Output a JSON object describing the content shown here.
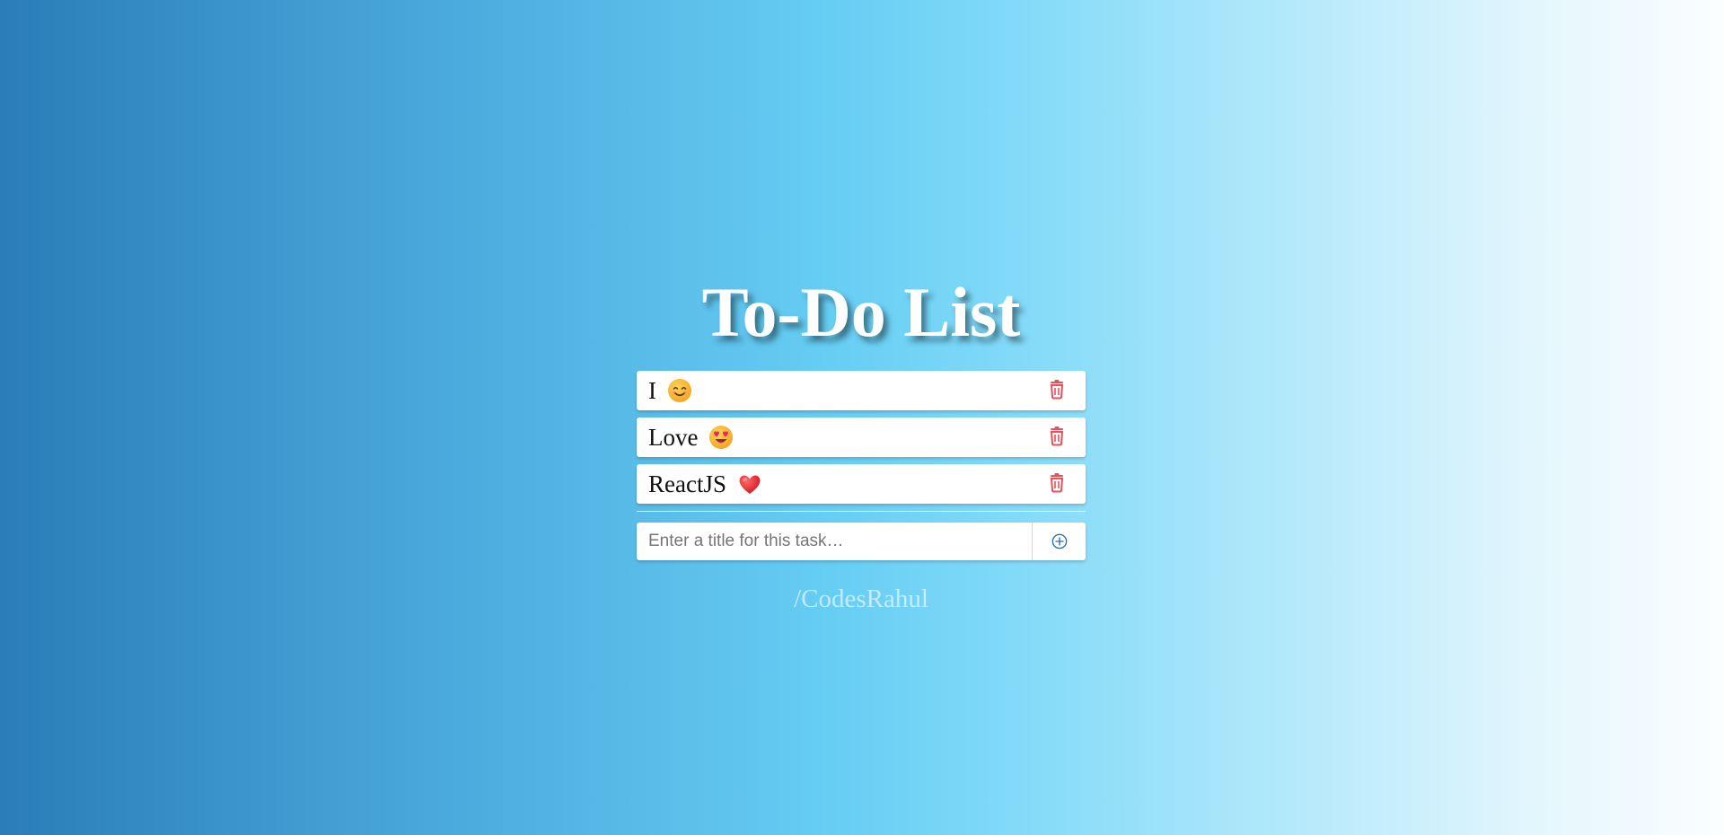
{
  "app": {
    "title": "To-Do List"
  },
  "tasks": [
    {
      "text": "I",
      "emoji": "smiling-face-icon"
    },
    {
      "text": "Love",
      "emoji": "heart-eyes-face-icon"
    },
    {
      "text": "ReactJS",
      "emoji": "red-heart-icon"
    }
  ],
  "add_form": {
    "placeholder": "Enter a title for this task…",
    "value": ""
  },
  "footer": {
    "link_text": "/CodesRahul"
  },
  "colors": {
    "trash_icon": "#e8505a",
    "add_icon": "#2a6fb0",
    "title_text": "#ffffff"
  }
}
